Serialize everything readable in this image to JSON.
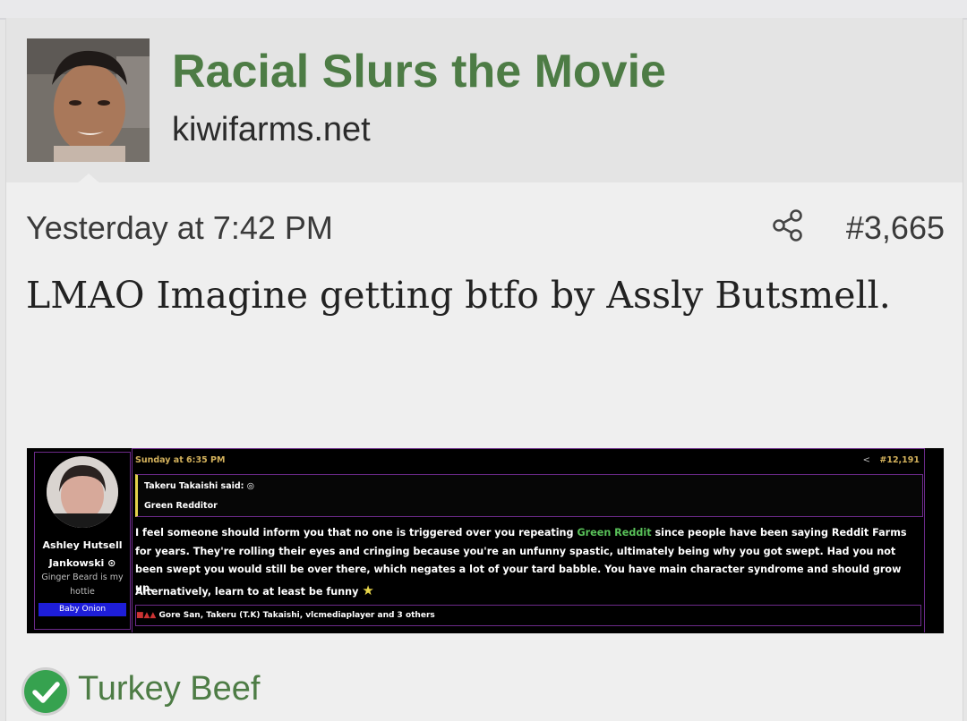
{
  "thread": {
    "title": "Racial Slurs the Movie",
    "site": "kiwifarms.net"
  },
  "post": {
    "date": "Yesterday at 7:42 PM",
    "number": "#3,665",
    "share_icon": "share-icon",
    "body": "LMAO Imagine getting btfo by Assly Butsmell."
  },
  "embed": {
    "user": {
      "name_line1": "Ashley Hutsell",
      "name_line2": "Jankowski",
      "title_line1": "Ginger Beard is my",
      "title_line2": "hottie",
      "banner": "Baby Onion",
      "banner_color": "#1e1ed8"
    },
    "date": "Sunday at 6:35 PM",
    "number": "#12,191",
    "quote": {
      "author": "Takeru Takaishi said:",
      "text": "Green Redditor"
    },
    "body_part1": "I feel someone should inform you that no one is triggered over you repeating",
    "body_link": "Green Reddit",
    "body_part2": "since people have been saying Reddit Farms for years. They're rolling their eyes and cringing because you're an unfunny spastic, ultimately being why you got swept. Had you not been swept you would still be over there, which negates a lot of your tard babble. You have main character syndrome and should grow up.",
    "body_line2": "Alternatively, learn to at least be funny",
    "reactions": "Gore San, Takeru (T.K) Takaishi, vlcmediaplayer and 3 others"
  },
  "reaction": {
    "label": "Turkey Beef",
    "icon": "check-circle-icon",
    "color": "#36a24f"
  },
  "colors": {
    "title_green": "#4d7c45",
    "embed_border": "#6c2a8a",
    "embed_date": "#d4b25c",
    "embed_link": "#59c159"
  }
}
